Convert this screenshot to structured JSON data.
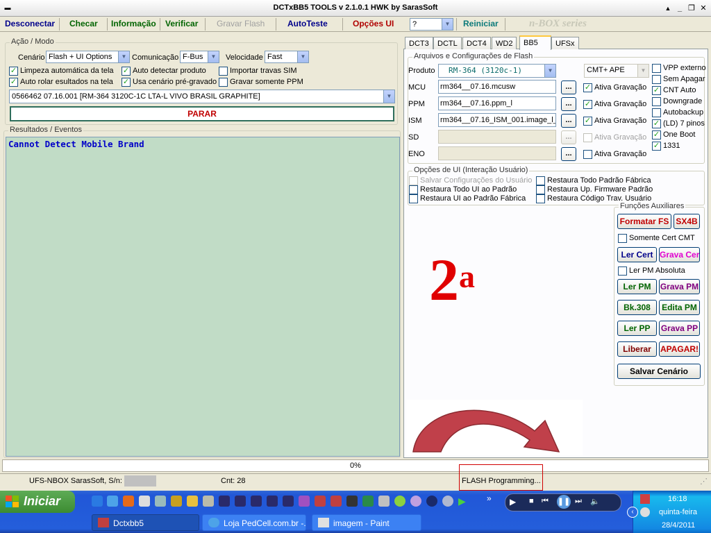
{
  "window": {
    "title": "DCTxBB5 TOOLS v 2.1.0.1 HWK by SarasSoft",
    "sys_glyph": "▬",
    "min_glyph": "▲",
    "minimize_glyph": "_",
    "restore_glyph": "❐",
    "close_glyph": "✕"
  },
  "menu": {
    "desconectar": "Desconectar",
    "checar": "Checar",
    "informacao": "Informação",
    "verificar": "Verificar",
    "gravar_flash": "Gravar Flash",
    "autoteste": "AutoTeste",
    "opcoes_ui": "Opções UI",
    "help_value": "?",
    "reiniciar": "Reiniciar",
    "nbox": "n-BOX series"
  },
  "acao": {
    "caption": "Ação / Modo",
    "cenario_label": "Cenário",
    "cenario_value": "Flash + UI Options",
    "comunicacao_label": "Comunicação",
    "comunicacao_value": "F-Bus",
    "velocidade_label": "Velocidade",
    "velocidade_value": "Fast",
    "cb_limpeza": "Limpeza automática da tela",
    "cb_auto_detectar": "Auto detectar produto",
    "cb_importar": "Importar travas SIM",
    "cb_auto_rolar": "Auto rolar esultados na tela",
    "cb_usa_cenario": "Usa cenário pré-gravado",
    "cb_gravar_ppm": "Gravar somente PPM",
    "product_value": "0566462 07.16.001  [RM-364 3120C-1C LTA-L VIVO BRASIL GRAPHITE]",
    "parar": "PARAR"
  },
  "resultados": {
    "caption": "Resultados / Eventos",
    "log_line": "Cannot Detect Mobile Brand",
    "bg_color": "#c1dcc6",
    "text_color": "#0000c8"
  },
  "tabs": {
    "dct3": "DCT3",
    "dctl": "DCTL",
    "dct4": "DCT4",
    "wd2": "WD2",
    "bb5": "BB5",
    "ufsx": "UFSx"
  },
  "flash": {
    "caption": "Arquivos e Configurações de Flash",
    "produto_label": "Produto",
    "produto_value": "RM-364 (3120c-1)",
    "cmt_value": "CMT+ APE",
    "mcu_label": "MCU",
    "mcu_value": "rm364__07.16.mcusw",
    "ppm_label": "PPM",
    "ppm_value": "rm364__07.16.ppm_l",
    "ism_label": "ISM",
    "ism_value": "rm364__07.16_ISM_001.image_l_",
    "sd_label": "SD",
    "eno_label": "ENO",
    "dots": "...",
    "ativa": "Ativa Gravação",
    "vpp": "VPP externo",
    "sem_apagar": "Sem Apagar",
    "cnt_auto": "CNT Auto",
    "downgrade": "Downgrade",
    "autobackup": "Autobackup",
    "ld7": "(LD) 7 pinos",
    "one_boot": "One Boot",
    "n1331": "1331"
  },
  "opcoes": {
    "caption": "Opções de UI (Interação Usuário)",
    "salvar_conf": "Salvar Configurações do Usuário",
    "restaura_todo_ui": "Restaura Todo UI ao Padrão",
    "restaura_ui_fabrica": "Restaura UI ao Padrão Fábrica",
    "restaura_todo_fabrica": "Restaura Todo Padrão Fábrica",
    "restaura_up_firmware": "Restaura Up. Firmware Padrão",
    "restaura_codigo": "Restaura Código Trav. Usuário"
  },
  "aux": {
    "caption": "Funções Auxiliares",
    "formatar_fs": "Formatar FS",
    "sx4b": "SX4B",
    "somente_cert": "Somente Cert CMT",
    "ler_cert": "Ler Cert",
    "grava_cert": "Grava Cert",
    "ler_pm_absoluta": "Ler PM Absoluta",
    "ler_pm": "Ler PM",
    "grava_pm": "Grava PM",
    "bk308": "Bk.308",
    "edita_pm": "Edita PM",
    "ler_pp": "Ler PP",
    "grava_pp": "Grava PP",
    "liberar": "Liberar",
    "apagar": "APAGAR!",
    "salvar_cenario": "Salvar Cenário"
  },
  "annotation": {
    "big_text": "2",
    "sup_text": "a",
    "color": "#e00000"
  },
  "progress": {
    "percent_text": "0%",
    "fraction": 0
  },
  "status": {
    "device": "UFS-NBOX  SarasSoft, S/n:",
    "cnt": "Cnt: 28",
    "flash_prog": "FLASH Programming..."
  },
  "taskbar": {
    "start": "Iniciar",
    "task1": "Dctxbb5",
    "task2": "Loja PedCell.com.br -...",
    "task3": "imagem - Paint",
    "time": "16:18",
    "weekday": "quinta-feira",
    "date": "28/4/2011",
    "chevron": "»"
  }
}
